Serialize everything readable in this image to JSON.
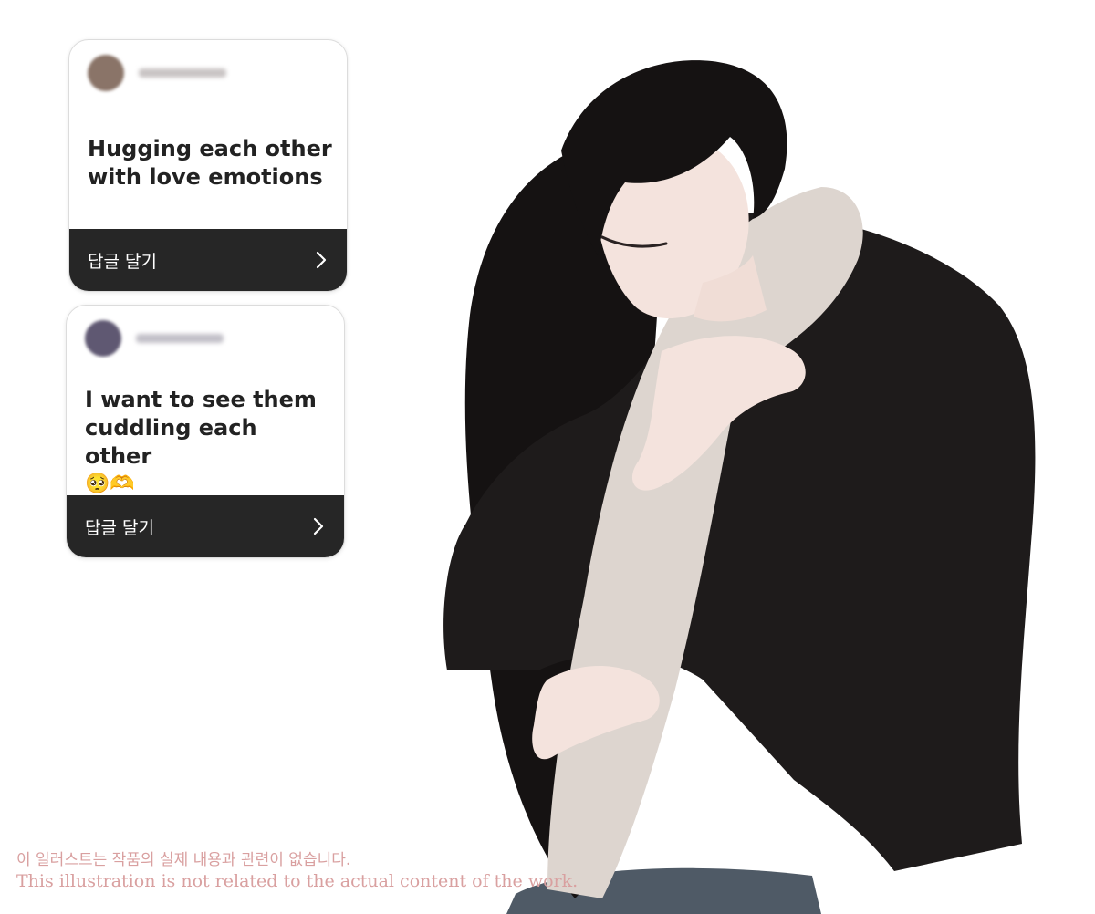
{
  "cards": [
    {
      "message": "Hugging each other with love emotions",
      "emoji": "",
      "reply_label": "답글 달기",
      "avatar_color": "#8a7468",
      "username_color": "#c9c4c4"
    },
    {
      "message": "I want to see them cuddling each other",
      "emoji": "🥺🫶",
      "reply_label": "답글 달기",
      "avatar_color": "#5f5872",
      "username_color": "#c2c0c8"
    }
  ],
  "caption": {
    "korean": "이 일러스트는 작품의 실제 내용과 관련이 없습니다.",
    "english": "This illustration is not related to the actual content of the work.",
    "color": "#d9a0a0"
  },
  "colors": {
    "reply_bar": "#262626",
    "jacket": "#1e1b1b",
    "hair": "#151212",
    "shirt": "#ddd5cf",
    "skin": "#f4e3dd"
  }
}
